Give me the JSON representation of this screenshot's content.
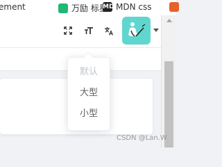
{
  "bookmarks": [
    {
      "label": "ement"
    },
    {
      "label": "万励 标星"
    },
    {
      "icon": "MDN",
      "label": "MDN css"
    },
    {
      "label": ""
    }
  ],
  "header": {
    "tools": [
      {
        "icon": "fullscreen-icon"
      },
      {
        "icon": "font-size-icon"
      },
      {
        "icon": "translate-icon"
      }
    ],
    "avatar": {
      "background": "#5fd7cf"
    }
  },
  "size_dropdown": {
    "items": [
      {
        "label": "默认",
        "disabled": true
      },
      {
        "label": "大型"
      },
      {
        "label": "小型"
      }
    ]
  },
  "watermark": "CSDN @Lan.W"
}
